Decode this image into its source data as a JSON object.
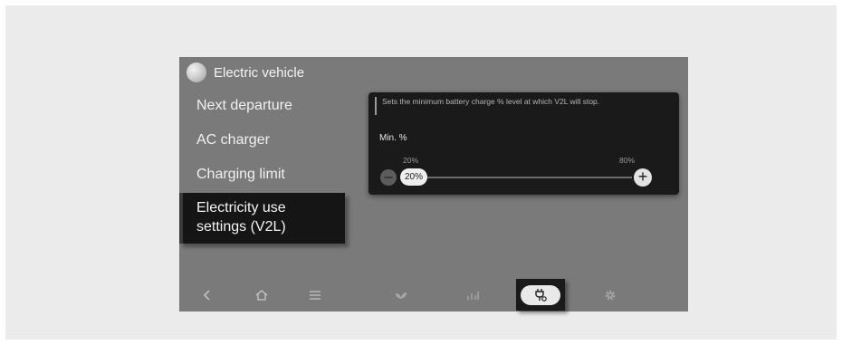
{
  "header": {
    "title": "Electric vehicle"
  },
  "menu": {
    "items": [
      {
        "label": "Next departure"
      },
      {
        "label": "AC charger"
      },
      {
        "label": "Charging limit"
      },
      {
        "label": "Electricity use settings (V2L)",
        "line1": "Electricity use",
        "line2": "settings (V2L)",
        "active": true
      }
    ]
  },
  "panel": {
    "description": "Sets the minimum battery charge % level at which V2L will stop.",
    "min_label": "Min. %",
    "slider": {
      "tick_min": "20%",
      "tick_max": "80%",
      "value_label": "20%",
      "value": 20,
      "min": 20,
      "max": 80
    }
  },
  "bottom_nav": {
    "items": [
      {
        "icon": "back-icon"
      },
      {
        "icon": "home-icon"
      },
      {
        "icon": "menu-icon"
      },
      {
        "icon": "eco-leaf-icon"
      },
      {
        "icon": "energy-stats-icon"
      },
      {
        "icon": "charging-plug-icon",
        "active": true
      },
      {
        "icon": "settings-gear-icon"
      }
    ]
  },
  "colors": {
    "screen_bg": "#7a7a7a",
    "panel_bg": "#1a1a1a",
    "active_bg": "#151515",
    "text": "#f0f0f0"
  }
}
